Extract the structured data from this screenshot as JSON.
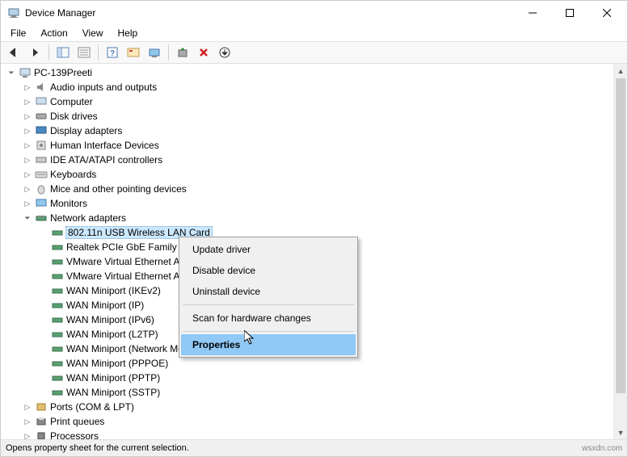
{
  "window": {
    "title": "Device Manager"
  },
  "menu": {
    "file": "File",
    "action": "Action",
    "view": "View",
    "help": "Help"
  },
  "tree": {
    "root": "PC-139Preeti",
    "cat0": "Audio inputs and outputs",
    "cat1": "Computer",
    "cat2": "Disk drives",
    "cat3": "Display adapters",
    "cat4": "Human Interface Devices",
    "cat5": "IDE ATA/ATAPI controllers",
    "cat6": "Keyboards",
    "cat7": "Mice and other pointing devices",
    "cat8": "Monitors",
    "cat9": "Network adapters",
    "na0": "802.11n USB Wireless LAN Card",
    "na1": "Realtek PCIe GbE Family C",
    "na2": "VMware Virtual Ethernet A",
    "na3": "VMware Virtual Ethernet A",
    "na4": "WAN Miniport (IKEv2)",
    "na5": "WAN Miniport (IP)",
    "na6": "WAN Miniport (IPv6)",
    "na7": "WAN Miniport (L2TP)",
    "na8": "WAN Miniport (Network Monitor)",
    "na9": "WAN Miniport (PPPOE)",
    "na10": "WAN Miniport (PPTP)",
    "na11": "WAN Miniport (SSTP)",
    "cat10": "Ports (COM & LPT)",
    "cat11": "Print queues",
    "cat12": "Processors"
  },
  "context": {
    "update": "Update driver",
    "disable": "Disable device",
    "uninstall": "Uninstall device",
    "scan": "Scan for hardware changes",
    "props": "Properties"
  },
  "status": {
    "text": "Opens property sheet for the current selection.",
    "watermark": "wsxdn.com"
  }
}
